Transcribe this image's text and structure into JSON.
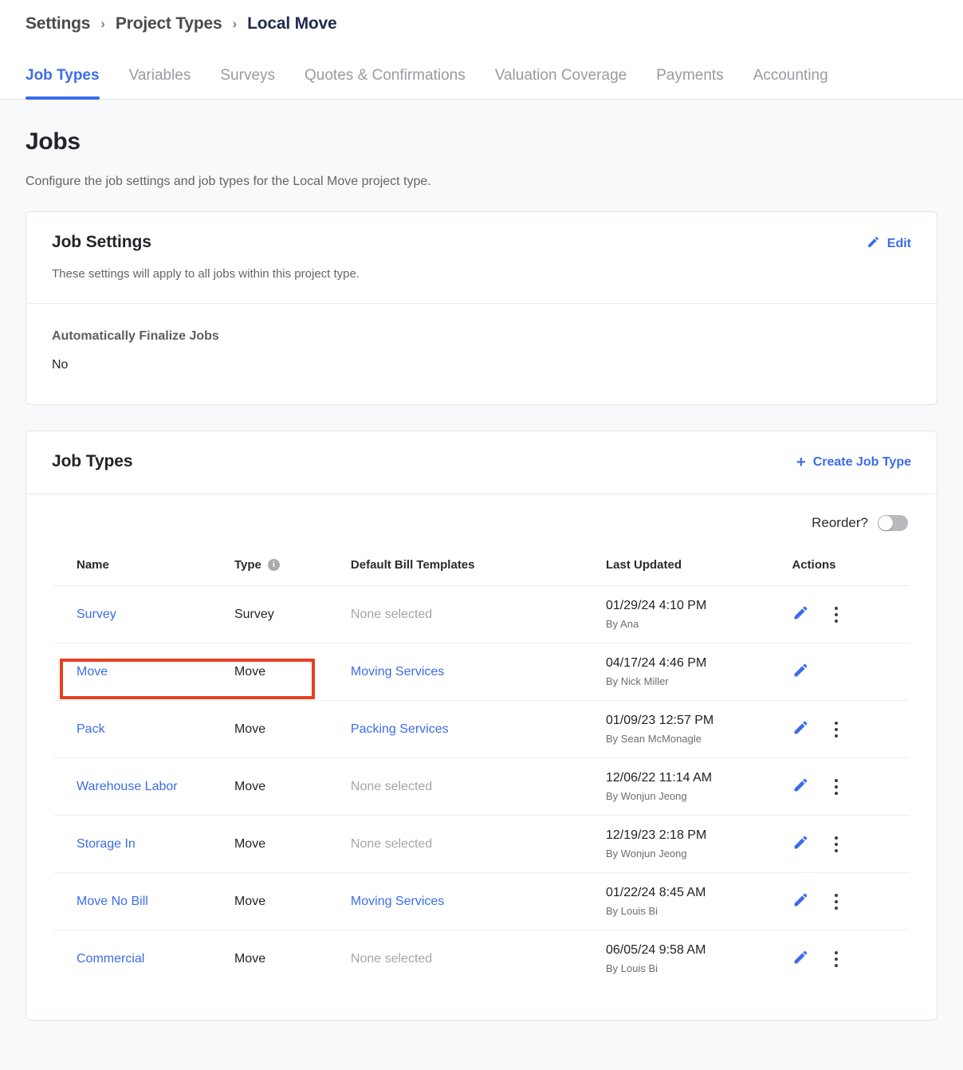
{
  "breadcrumb": {
    "items": [
      {
        "label": "Settings",
        "current": false
      },
      {
        "label": "Project Types",
        "current": false
      },
      {
        "label": "Local Move",
        "current": true
      }
    ],
    "separator": "›"
  },
  "tabs": [
    {
      "label": "Job Types",
      "active": true
    },
    {
      "label": "Variables",
      "active": false
    },
    {
      "label": "Surveys",
      "active": false
    },
    {
      "label": "Quotes & Confirmations",
      "active": false
    },
    {
      "label": "Valuation Coverage",
      "active": false
    },
    {
      "label": "Payments",
      "active": false
    },
    {
      "label": "Accounting",
      "active": false
    }
  ],
  "page": {
    "title": "Jobs",
    "subtitle": "Configure the job settings and job types for the Local Move project type."
  },
  "job_settings": {
    "title": "Job Settings",
    "description": "These settings will apply to all jobs within this project type.",
    "edit_label": "Edit",
    "edit_icon": "pencil-icon",
    "field_label": "Automatically Finalize Jobs",
    "field_value": "No"
  },
  "job_types": {
    "title": "Job Types",
    "create_label": "Create Job Type",
    "create_icon": "plus-icon",
    "reorder_label": "Reorder?",
    "reorder_on": false,
    "columns": [
      {
        "label": "Name",
        "info": false
      },
      {
        "label": "Type",
        "info": true
      },
      {
        "label": "Default Bill Templates",
        "info": false
      },
      {
        "label": "Last Updated",
        "info": false
      },
      {
        "label": "Actions",
        "info": false
      }
    ],
    "rows": [
      {
        "name": "Survey",
        "type": "Survey",
        "template": "None selected",
        "template_is_link": false,
        "updated": "01/29/24 4:10 PM",
        "updated_by": "By Ana",
        "has_kebab": true,
        "highlighted": false
      },
      {
        "name": "Move",
        "type": "Move",
        "template": "Moving Services",
        "template_is_link": true,
        "updated": "04/17/24 4:46 PM",
        "updated_by": "By Nick Miller",
        "has_kebab": false,
        "highlighted": true
      },
      {
        "name": "Pack",
        "type": "Move",
        "template": "Packing Services",
        "template_is_link": true,
        "updated": "01/09/23 12:57 PM",
        "updated_by": "By Sean McMonagle",
        "has_kebab": true,
        "highlighted": false
      },
      {
        "name": "Warehouse Labor",
        "type": "Move",
        "template": "None selected",
        "template_is_link": false,
        "updated": "12/06/22 11:14 AM",
        "updated_by": "By Wonjun Jeong",
        "has_kebab": true,
        "highlighted": false
      },
      {
        "name": "Storage In",
        "type": "Move",
        "template": "None selected",
        "template_is_link": false,
        "updated": "12/19/23 2:18 PM",
        "updated_by": "By Wonjun Jeong",
        "has_kebab": true,
        "highlighted": false
      },
      {
        "name": "Move No Bill",
        "type": "Move",
        "template": "Moving Services",
        "template_is_link": true,
        "updated": "01/22/24 8:45 AM",
        "updated_by": "By Louis Bi",
        "has_kebab": true,
        "highlighted": false
      },
      {
        "name": "Commercial",
        "type": "Move",
        "template": "None selected",
        "template_is_link": false,
        "updated": "06/05/24 9:58 AM",
        "updated_by": "By Louis Bi",
        "has_kebab": true,
        "highlighted": false
      }
    ],
    "row_edit_icon": "pencil-icon",
    "row_menu_icon": "kebab-menu-icon"
  },
  "annotation": {
    "highlight_color": "#e8401f",
    "target": "Move"
  },
  "colors": {
    "accent": "#3c6ce8",
    "link": "#3c6ce8",
    "page_bg": "#f8f9fa",
    "text": "#23242a",
    "muted": "#a4a5a9",
    "breadcrumb_current": "#1f2b51"
  }
}
